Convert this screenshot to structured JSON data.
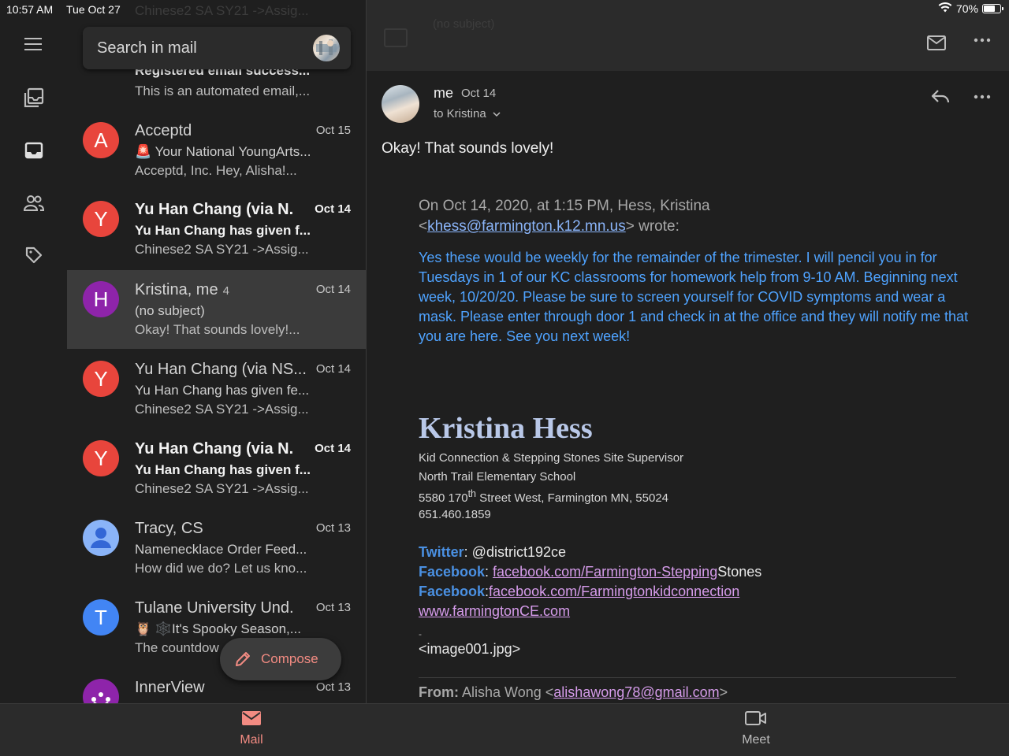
{
  "status": {
    "time": "10:57 AM",
    "date": "Tue Oct 27",
    "battery": "70%"
  },
  "search": {
    "placeholder": "Search in mail"
  },
  "list": {
    "ghost_header": "Chinese2 SA SY21 ->Assig...",
    "partial_top": {
      "subject": "Registered email success...",
      "snippet": "This is an automated email,..."
    },
    "items": [
      {
        "initial": "A",
        "color": "#e8453c",
        "sender": "Acceptd",
        "count": "",
        "date": "Oct 15",
        "subject": "🚨 Your National YoungArts...",
        "snippet": "Acceptd, Inc. Hey, Alisha!...",
        "unread": false
      },
      {
        "initial": "Y",
        "color": "#e8453c",
        "sender": "Yu Han Chang (via N.",
        "count": "",
        "date": "Oct 14",
        "subject": "Yu Han Chang has given f...",
        "snippet": "Chinese2 SA SY21 ->Assig...",
        "unread": true
      },
      {
        "initial": "H",
        "color": "#8e24aa",
        "sender": "Kristina, me",
        "count": "4",
        "date": "Oct 14",
        "subject": "(no subject)",
        "snippet": "Okay! That sounds lovely!...",
        "unread": false
      },
      {
        "initial": "Y",
        "color": "#e8453c",
        "sender": "Yu Han Chang (via NS...",
        "count": "",
        "date": "Oct 14",
        "subject": "Yu Han Chang has given fe...",
        "snippet": "Chinese2 SA SY21 ->Assig...",
        "unread": false
      },
      {
        "initial": "Y",
        "color": "#e8453c",
        "sender": "Yu Han Chang (via N.",
        "count": "",
        "date": "Oct 14",
        "subject": "Yu Han Chang has given f...",
        "snippet": "Chinese2 SA SY21 ->Assig...",
        "unread": true
      },
      {
        "initial": "",
        "color": "#8ab4f8",
        "sender": "Tracy, CS",
        "count": "",
        "date": "Oct 13",
        "subject": "Namenecklace Order Feed...",
        "snippet": "How did we do? Let us kno...",
        "unread": false
      },
      {
        "initial": "T",
        "color": "#4285f4",
        "sender": "Tulane University Und.",
        "count": "",
        "date": "Oct 13",
        "subject": "🦉 🕸️It's Spooky Season,...",
        "snippet": "The countdow",
        "unread": false
      },
      {
        "initial": "",
        "color": "#8e24aa",
        "sender": "InnerView",
        "count": "",
        "date": "Oct 13",
        "subject": "",
        "snippet": "",
        "unread": false
      }
    ],
    "compose_label": "Compose"
  },
  "reader": {
    "ghost_title": "(no subject)",
    "from": "me",
    "date": "Oct 14",
    "to": "to Kristina",
    "body": "Okay! That sounds lovely!",
    "quote_header_1": "On Oct 14, 2020, at 1:15 PM, Hess, Kristina",
    "quote_header_lt": "<",
    "quote_email": "khess@farmington.k12.mn.us",
    "quote_header_2": "> wrote:",
    "quote_body": "Yes these would be weekly for the remainder of the trimester. I will pencil you in for Tuesdays in 1 of our KC classrooms for homework help from 9-10 AM. Beginning next week, 10/20/20. Please be sure to screen yourself for COVID symptoms and wear a mask. Please enter through door 1 and check in at the office and they will notify me that you are here. See you next week!",
    "sig_name": "Kristina Hess",
    "sig_title": "Kid Connection & Stepping Stones Site Supervisor",
    "sig_school": "North Trail Elementary School",
    "sig_addr_a": "5580 170",
    "sig_addr_sup": "th",
    "sig_addr_b": " Street West, Farmington MN, 55024",
    "sig_phone": "651.460.1859",
    "twitter_label": "Twitter",
    "twitter_value": ": @district192ce",
    "fb1_label": "Facebook",
    "fb1_sep": ": ",
    "fb1_link": "facebook.com/Farmington-Stepping",
    "fb1_tail": "Stones",
    "fb2_label": "Facebook",
    "fb2_sep": ":",
    "fb2_link": "facebook.com/Farmingtonkidconnection",
    "web_link": "www.farmingtonCE.com",
    "dash": "-",
    "image_ref": "<image001.jpg>",
    "fromq_label": "From:",
    "fromq_name": " Alisha Wong <",
    "fromq_email": "alishawong78@gmail.com",
    "fromq_end": ">"
  },
  "bottom": {
    "mail": "Mail",
    "meet": "Meet"
  },
  "colors": {
    "accent": "#f28b82",
    "link": "#8ab4f8",
    "quote_blue": "#4fa3ff"
  }
}
